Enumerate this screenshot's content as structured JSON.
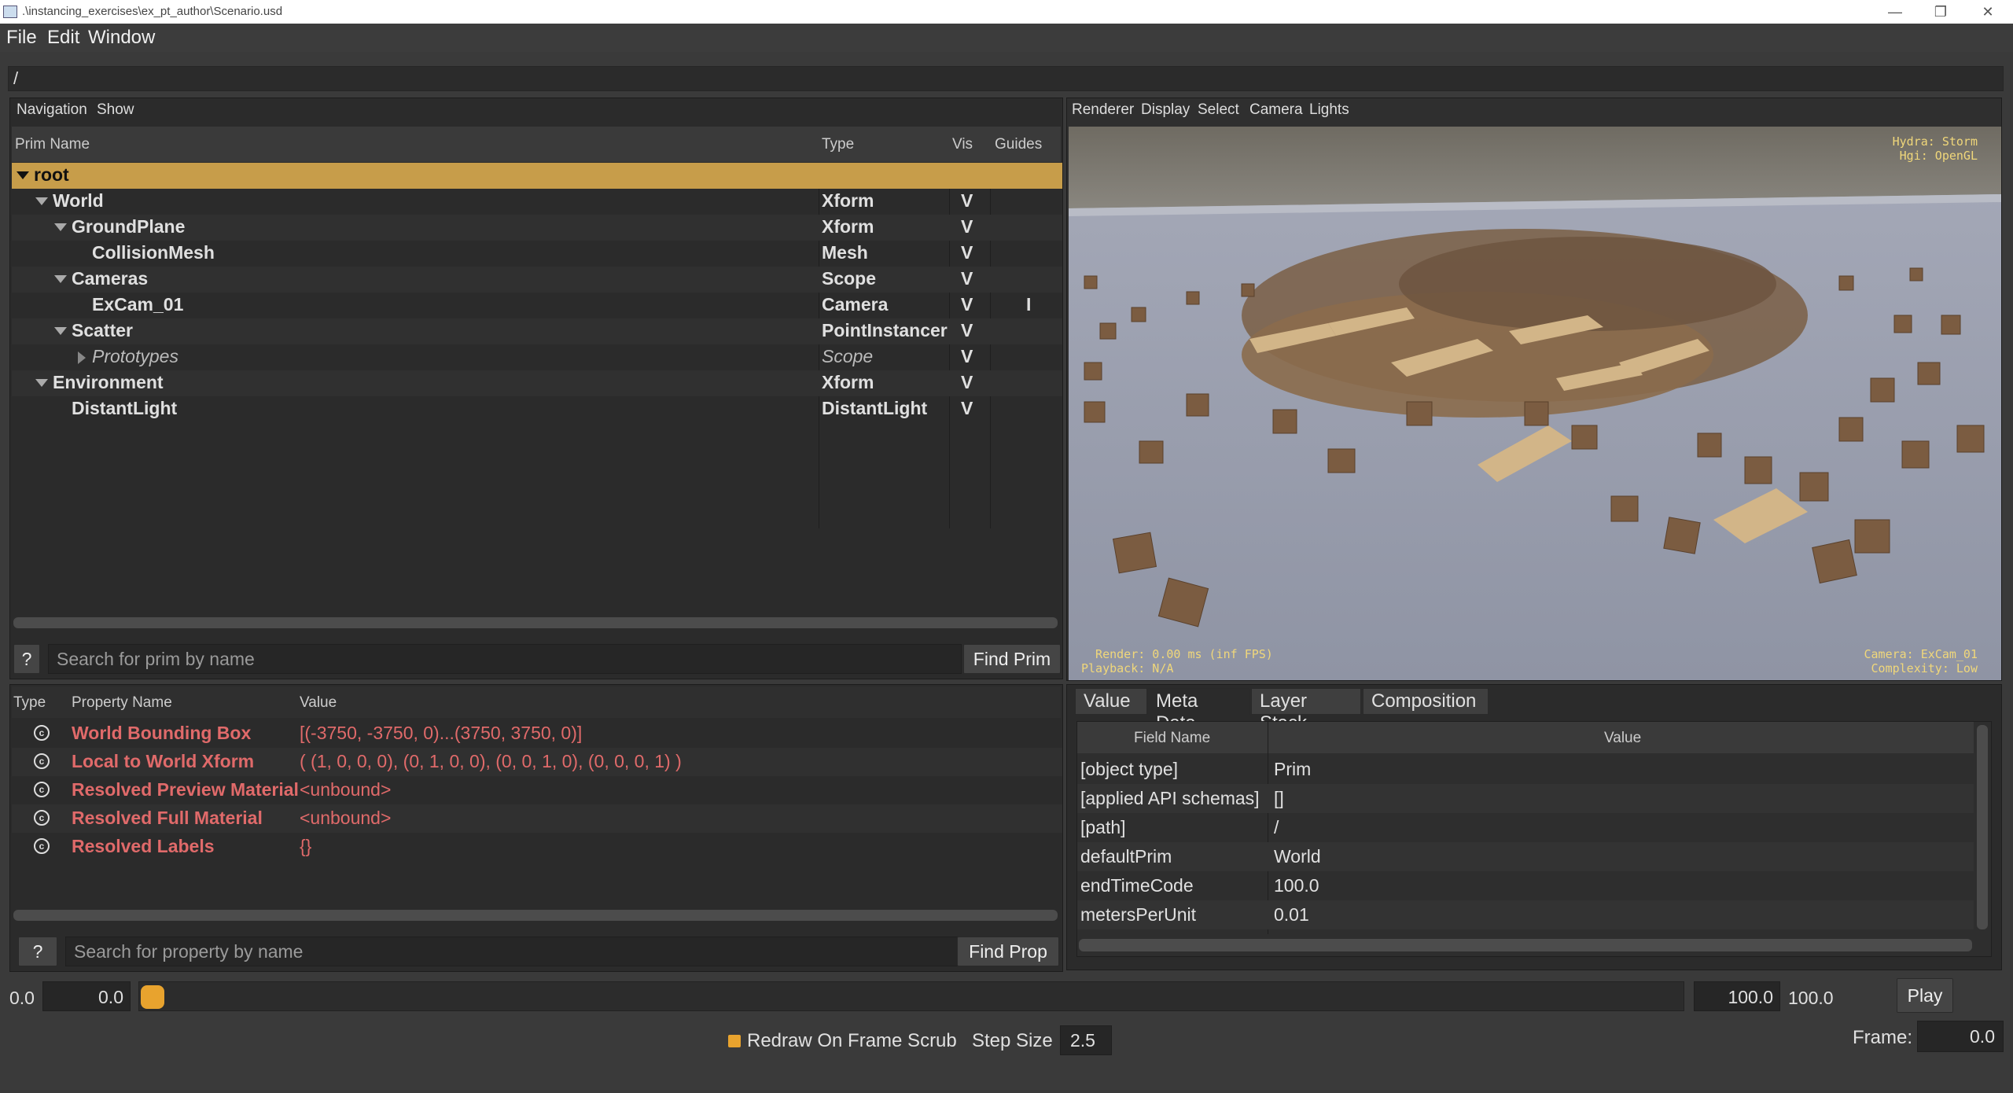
{
  "window": {
    "title": ".\\instancing_exercises\\ex_pt_author\\Scenario.usd"
  },
  "menu": {
    "file": "File",
    "edit": "Edit",
    "window": "Window"
  },
  "path": "/",
  "tree_panel": {
    "menu": {
      "navigation": "Navigation",
      "show": "Show"
    },
    "headers": {
      "name": "Prim Name",
      "type": "Type",
      "vis": "Vis",
      "guides": "Guides"
    },
    "rows": [
      {
        "name": "root",
        "type": "",
        "vis": "",
        "guides": ""
      },
      {
        "name": "World",
        "type": "Xform",
        "vis": "V",
        "guides": ""
      },
      {
        "name": "GroundPlane",
        "type": "Xform",
        "vis": "V",
        "guides": ""
      },
      {
        "name": "CollisionMesh",
        "type": "Mesh",
        "vis": "V",
        "guides": ""
      },
      {
        "name": "Cameras",
        "type": "Scope",
        "vis": "V",
        "guides": ""
      },
      {
        "name": "ExCam_01",
        "type": "Camera",
        "vis": "V",
        "guides": "I"
      },
      {
        "name": "Scatter",
        "type": "PointInstancer",
        "vis": "V",
        "guides": ""
      },
      {
        "name": "Prototypes",
        "type": "Scope",
        "vis": "V",
        "guides": ""
      },
      {
        "name": "Environment",
        "type": "Xform",
        "vis": "V",
        "guides": ""
      },
      {
        "name": "DistantLight",
        "type": "DistantLight",
        "vis": "V",
        "guides": ""
      }
    ],
    "help": "?",
    "search_placeholder": "Search for prim by name",
    "find_button": "Find Prim"
  },
  "prop_panel": {
    "headers": {
      "type": "Type",
      "name": "Property Name",
      "value": "Value"
    },
    "rows": [
      {
        "name": "World Bounding Box",
        "value": "[(-3750, -3750, 0)...(3750, 3750, 0)]"
      },
      {
        "name": "Local to World Xform",
        "value": "( (1, 0, 0, 0), (0, 1, 0, 0), (0, 0, 1, 0), (0, 0, 0, 1) )"
      },
      {
        "name": "Resolved Preview Material",
        "value": "<unbound>"
      },
      {
        "name": "Resolved Full Material",
        "value": "<unbound>"
      },
      {
        "name": "Resolved Labels",
        "value": "{}"
      }
    ],
    "help": "?",
    "search_placeholder": "Search for property by name",
    "find_button": "Find Prop"
  },
  "viewport": {
    "menu": {
      "renderer": "Renderer",
      "display": "Display",
      "select": "Select",
      "camera": "Camera",
      "lights": "Lights"
    },
    "hud_top_right": "Hydra: Storm\nHgi: OpenGL",
    "hud_bottom_left": "  Render: 0.00 ms (inf FPS)\nPlayback: N/A",
    "hud_bottom_right": " Camera: ExCam_01\nComplexity: Low"
  },
  "inspector": {
    "tabs": [
      "Value",
      "Meta Data",
      "Layer Stack",
      "Composition"
    ],
    "headers": {
      "field": "Field Name",
      "value": "Value"
    },
    "rows": [
      {
        "field": "[object type]",
        "value": "Prim"
      },
      {
        "field": "[applied API schemas]",
        "value": "[]"
      },
      {
        "field": "[path]",
        "value": "/"
      },
      {
        "field": "defaultPrim",
        "value": "World"
      },
      {
        "field": "endTimeCode",
        "value": "100.0"
      },
      {
        "field": "metersPerUnit",
        "value": "0.01"
      }
    ]
  },
  "timeline": {
    "start_label": "0.0",
    "start_value": "0.0",
    "end_value": "100.0",
    "end_label": "100.0",
    "play_button": "Play",
    "redraw_label": "Redraw On Frame Scrub",
    "step_label": "Step Size",
    "step_value": "2.5",
    "frame_label": "Frame:",
    "frame_value": "0.0",
    "slider_position": 0.0,
    "accent_color": "#e8a32e"
  }
}
